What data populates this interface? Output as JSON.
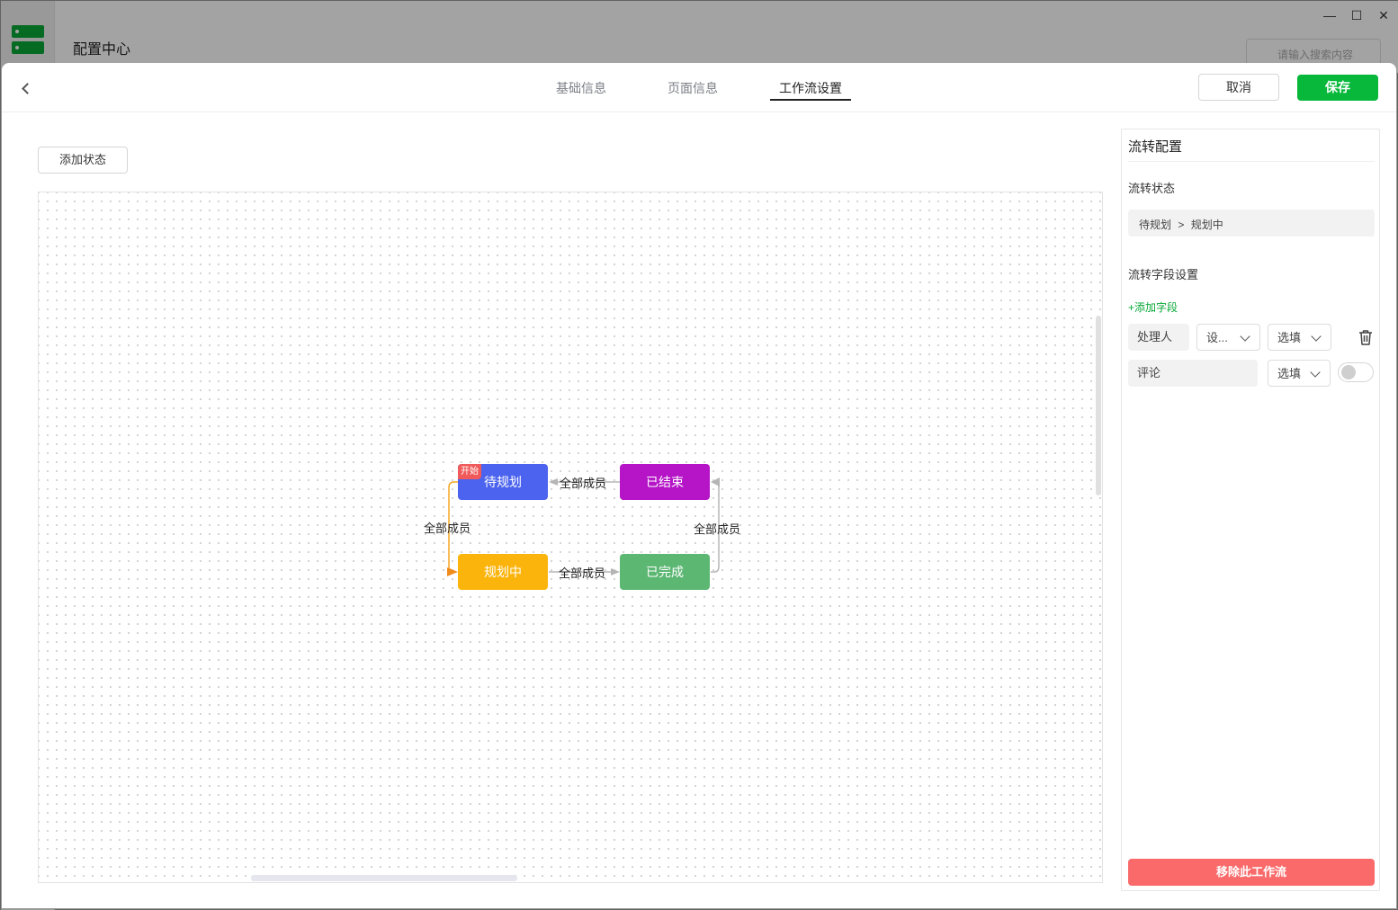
{
  "app": {
    "title": "配置中心",
    "search_placeholder": "请输入搜索内容",
    "window_controls": [
      "minimize-icon",
      "maximize-icon",
      "close-icon"
    ]
  },
  "header": {
    "tabs": [
      {
        "label": "基础信息",
        "active": false
      },
      {
        "label": "页面信息",
        "active": false
      },
      {
        "label": "工作流设置",
        "active": true
      }
    ],
    "cancel_label": "取消",
    "save_label": "保存"
  },
  "toolbar": {
    "add_state_label": "添加状态"
  },
  "workflow": {
    "start_badge": "开始",
    "states": [
      {
        "id": "pending",
        "label": "待规划",
        "color": "#4b63ee",
        "is_start": true
      },
      {
        "id": "ended",
        "label": "已结束",
        "color": "#b514c7"
      },
      {
        "id": "planning",
        "label": "规划中",
        "color": "#fbb40c"
      },
      {
        "id": "done",
        "label": "已完成",
        "color": "#5cb773"
      }
    ],
    "transitions": [
      {
        "from": "ended",
        "to": "pending",
        "label": "全部成员"
      },
      {
        "from": "pending",
        "to": "planning",
        "label": "全部成员"
      },
      {
        "from": "planning",
        "to": "done",
        "label": "全部成员"
      },
      {
        "from": "done",
        "to": "ended",
        "label": "全部成员"
      }
    ]
  },
  "panel": {
    "title": "流转配置",
    "transition_state_label": "流转状态",
    "transition_from": "待规划",
    "transition_separator": ">",
    "transition_to": "规划中",
    "field_settings_label": "流转字段设置",
    "add_field_label": "+添加字段",
    "fields": [
      {
        "name": "处理人",
        "setting": "设...",
        "required": "选填"
      },
      {
        "name": "评论",
        "required": "选填",
        "toggle_on": false
      }
    ],
    "remove_label": "移除此工作流"
  },
  "colors": {
    "accent": "#08b83b",
    "danger": "#fa6a6a"
  }
}
